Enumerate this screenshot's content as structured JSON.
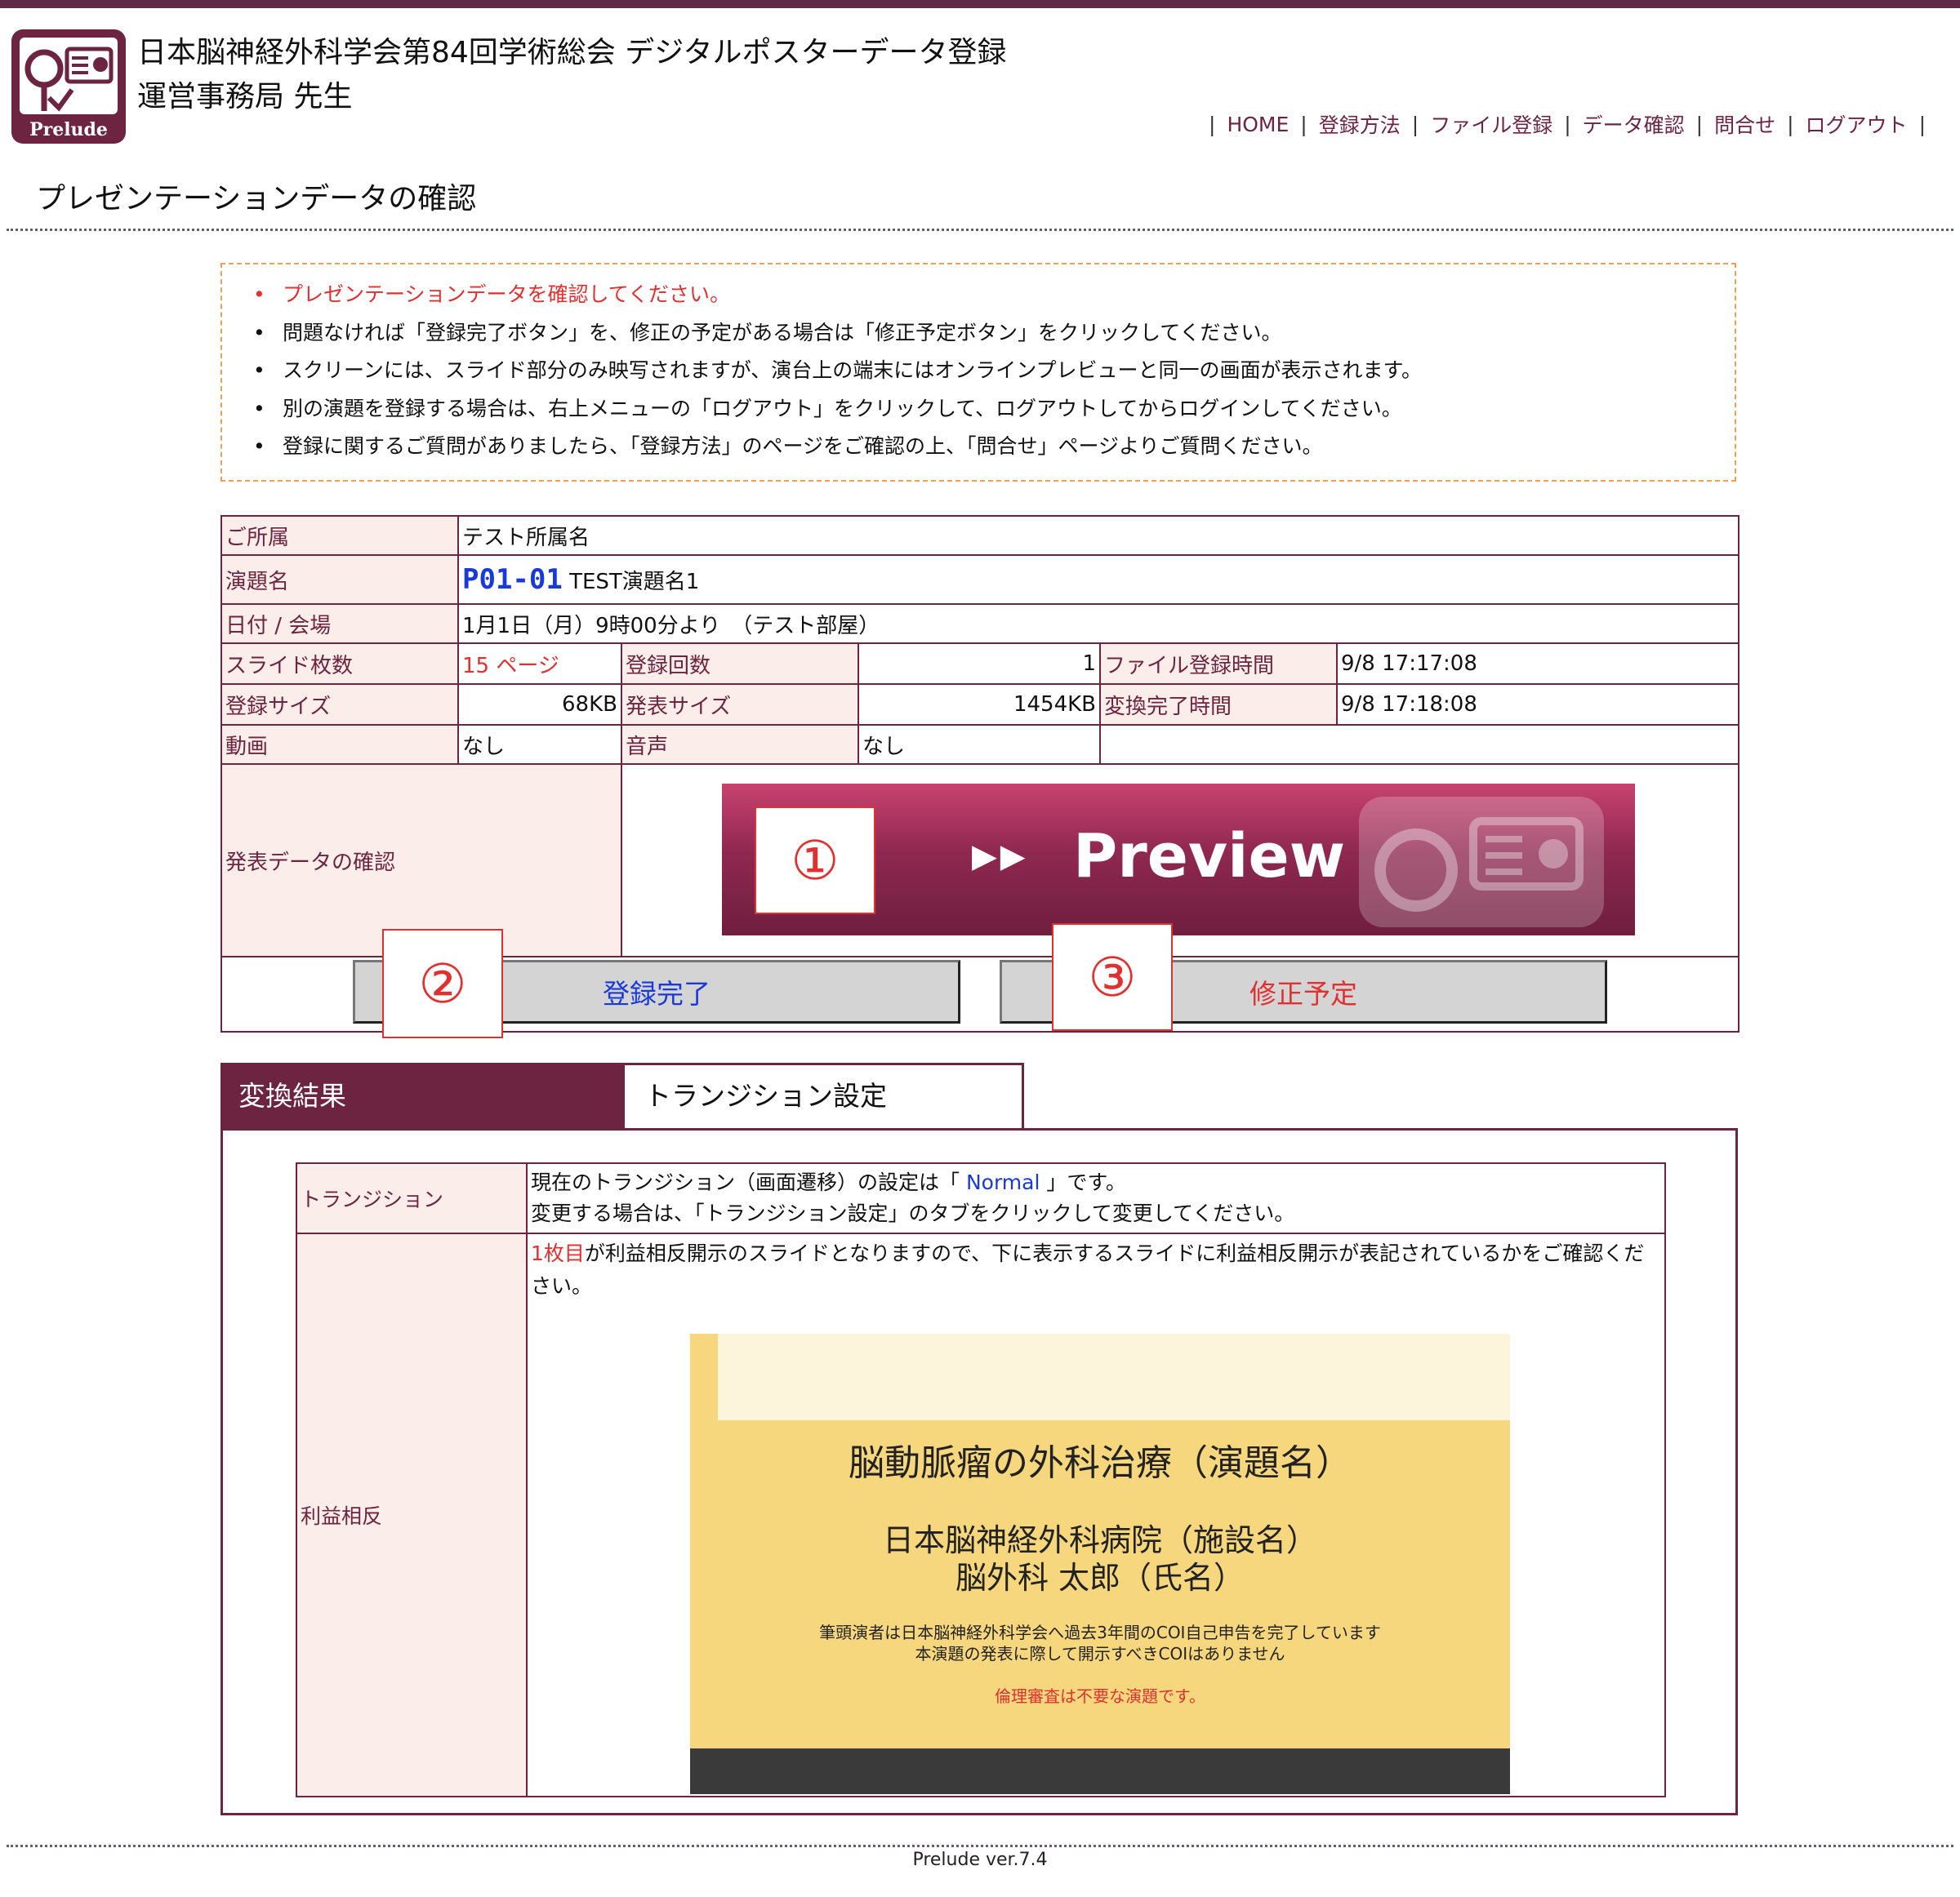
{
  "header": {
    "title_line1": "日本脳神経外科学会第84回学術総会 デジタルポスターデータ登録",
    "title_line2": "運営事務局 先生",
    "logo_text": "Prelude",
    "nav": [
      "HOME",
      "登録方法",
      "ファイル登録",
      "データ確認",
      "問合せ",
      "ログアウト"
    ]
  },
  "page_title": "プレゼンテーションデータの確認",
  "notices": [
    "プレゼンテーションデータを確認してください。",
    "問題なければ「登録完了ボタン」を、修正の予定がある場合は「修正予定ボタン」をクリックしてください。",
    "スクリーンには、スライド部分のみ映写されますが、演台上の端末にはオンラインプレビューと同一の画面が表示されます。",
    "別の演題を登録する場合は、右上メニューの「ログアウト」をクリックして、ログアウトしてからログインしてください。",
    "登録に関するご質問がありましたら、「登録方法」のページをご確認の上、「問合せ」ページよりご質問ください。"
  ],
  "info": {
    "affiliation_label": "ご所属",
    "affiliation": "テスト所属名",
    "title_label": "演題名",
    "code": "P01-01",
    "title": "TEST演題名1",
    "date_label": "日付 / 会場",
    "date": "1月1日（月）9時00分より　（テスト部屋）",
    "slides_label": "スライド枚数",
    "slides": "15 ページ",
    "reg_count_label": "登録回数",
    "reg_count": "1",
    "file_time_label": "ファイル登録時間",
    "file_time": "9/8 17:17:08",
    "reg_size_label": "登録サイズ",
    "reg_size": "68KB",
    "pres_size_label": "発表サイズ",
    "pres_size": "1454KB",
    "conv_time_label": "変換完了時間",
    "conv_time": "9/8 17:18:08",
    "video_label": "動画",
    "video": "なし",
    "audio_label": "音声",
    "audio": "なし",
    "check_label": "発表データの確認"
  },
  "preview": {
    "label": "Preview",
    "arrows": "▶▶"
  },
  "badges": {
    "one": "①",
    "two": "②",
    "three": "③"
  },
  "buttons": {
    "complete": "登録完了",
    "pending": "修正予定"
  },
  "tabs": {
    "active": "変換結果",
    "inactive": "トランジション設定"
  },
  "conversion": {
    "transition_label": "トランジション",
    "transition_pre": "現在のトランジション（画面遷移）の設定は「 ",
    "transition_value": "Normal",
    "transition_post": " 」です。",
    "transition_line2": "変更する場合は、「トランジション設定」のタブをクリックして変更してください。",
    "coi_label": "利益相反",
    "coi_highlight": "1枚目",
    "coi_text": "が利益相反開示のスライドとなりますので、下に表示するスライドに利益相反開示が表記されているかをご確認ください。"
  },
  "slide": {
    "title": "脳動脈瘤の外科治療（演題名）",
    "facility": "日本脳神経外科病院（施設名）",
    "name": "脳外科 太郎（氏名）",
    "coi1": "筆頭演者は日本脳神経外科学会へ過去3年間のCOI自己申告を完了しています",
    "coi2": "本演題の発表に際して開示すべきCOIはありません",
    "ethics": "倫理審査は不要な演題です。"
  },
  "footer": "Prelude ver.7.4",
  "colors": {
    "brand": "#6c2440",
    "label_bg": "#fbeeea",
    "accent_red": "#e03030",
    "link_blue": "#1a3ad8"
  }
}
